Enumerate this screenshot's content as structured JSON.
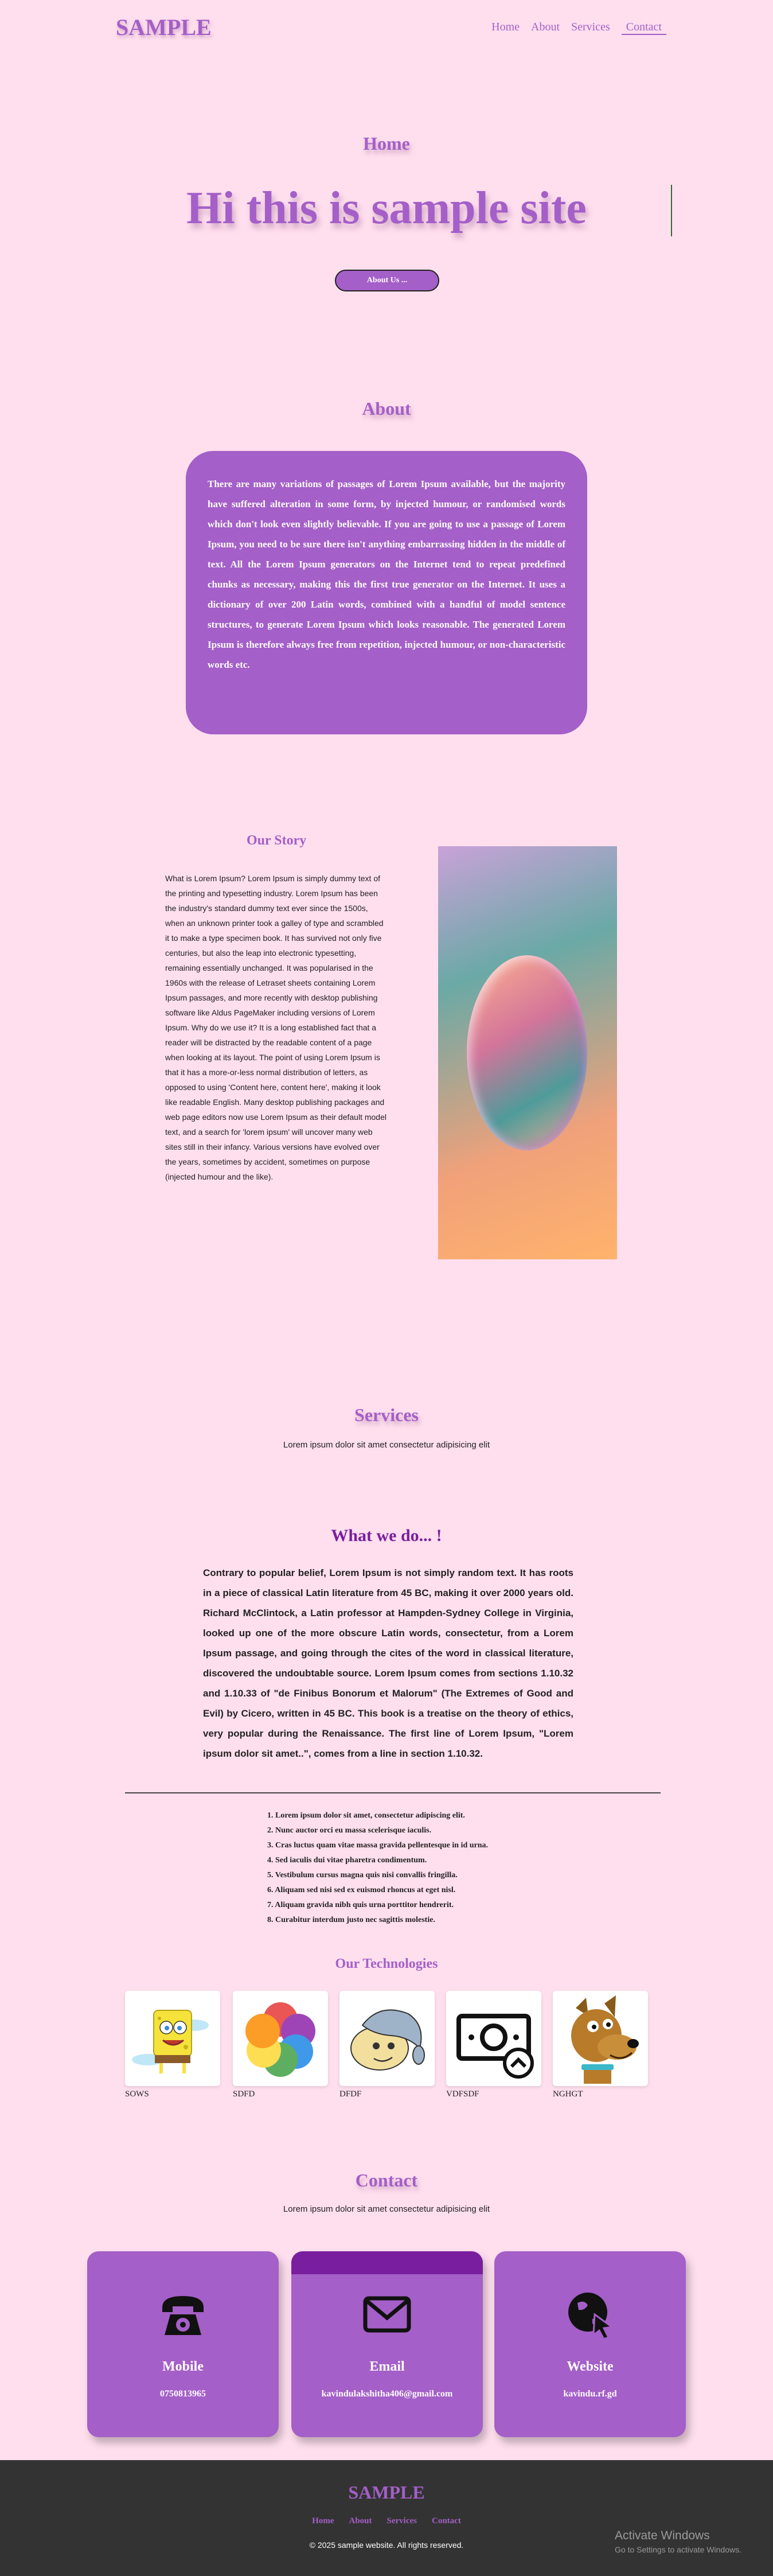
{
  "nav": {
    "logo": "SAMPLE",
    "links": [
      "Home",
      "About",
      "Services",
      "Contact"
    ]
  },
  "home": {
    "section_title": "Home",
    "hero": "Hi this is sample site",
    "button": "About Us ..."
  },
  "about": {
    "title": "About",
    "text": "There are many variations of passages of Lorem Ipsum available, but the majority have suffered alteration in some form, by injected humour, or randomised words which don't look even slightly believable. If you are going to use a passage of Lorem Ipsum, you need to be sure there isn't anything embarrassing hidden in the middle of text. All the Lorem Ipsum generators on the Internet tend to repeat predefined chunks as necessary, making this the first true generator on the Internet. It uses a dictionary of over 200 Latin words, combined with a handful of model sentence structures, to generate Lorem Ipsum which looks reasonable. The generated Lorem Ipsum is therefore always free from repetition, injected humour, or non-characteristic words etc."
  },
  "story": {
    "title": "Our Story",
    "text": "What is Lorem Ipsum? Lorem Ipsum is simply dummy text of the printing and typesetting industry. Lorem Ipsum has been the industry's standard dummy text ever since the 1500s, when an unknown printer took a galley of type and scrambled it to make a type specimen book. It has survived not only five centuries, but also the leap into electronic typesetting, remaining essentially unchanged. It was popularised in the 1960s with the release of Letraset sheets containing Lorem Ipsum passages, and more recently with desktop publishing software like Aldus PageMaker including versions of Lorem Ipsum. Why do we use it? It is a long established fact that a reader will be distracted by the readable content of a page when looking at its layout. The point of using Lorem Ipsum is that it has a more-or-less normal distribution of letters, as opposed to using 'Content here, content here', making it look like readable English. Many desktop publishing packages and web page editors now use Lorem Ipsum as their default model text, and a search for 'lorem ipsum' will uncover many web sites still in their infancy. Various versions have evolved over the years, sometimes by accident, sometimes on purpose (injected humour and the like)."
  },
  "services": {
    "title": "Services",
    "subtitle": "Lorem ipsum dolor sit amet consectetur adipisicing elit",
    "what_title": "What we do... !",
    "what_text": "Contrary to popular belief, Lorem Ipsum is not simply random text. It has roots in a piece of classical Latin literature from 45 BC, making it over 2000 years old. Richard McClintock, a Latin professor at Hampden-Sydney College in Virginia, looked up one of the more obscure Latin words, consectetur, from a Lorem Ipsum passage, and going through the cites of the word in classical literature, discovered the undoubtable source. Lorem Ipsum comes from sections 1.10.32 and 1.10.33 of \"de Finibus Bonorum et Malorum\" (The Extremes of Good and Evil) by Cicero, written in 45 BC. This book is a treatise on the theory of ethics, very popular during the Renaissance. The first line of Lorem Ipsum, \"Lorem ipsum dolor sit amet..\", comes from a line in section 1.10.32.",
    "list": [
      "1. Lorem ipsum dolor sit amet, consectetur adipiscing elit.",
      "2. Nunc auctor orci eu massa scelerisque iaculis.",
      "3. Cras luctus quam vitae massa gravida pellentesque in id urna.",
      "4. Sed iaculis dui vitae pharetra condimentum.",
      "5. Vestibulum cursus magna quis nisi convallis fringilla.",
      "6. Aliquam sed nisi sed ex euismod rhoncus at eget nisl.",
      "7. Aliquam gravida nibh quis urna porttitor hendrerit.",
      "8. Curabitur interdum justo nec sagittis molestie."
    ],
    "tech_title": "Our Technologies",
    "technologies": [
      {
        "label": "SOWS",
        "icon": "sponge-character-icon"
      },
      {
        "label": "SDFD",
        "icon": "color-flower-icon"
      },
      {
        "label": "DFDF",
        "icon": "cartoon-face-icon"
      },
      {
        "label": "VDFSDF",
        "icon": "money-icon"
      },
      {
        "label": "NGHGT",
        "icon": "cartoon-dog-icon"
      }
    ]
  },
  "contact": {
    "title": "Contact",
    "subtitle": "Lorem ipsum dolor sit amet consectetur adipisicing elit",
    "cards": [
      {
        "label": "Mobile",
        "value": "0750813965",
        "icon": "phone-icon"
      },
      {
        "label": "Email",
        "value": "kavindulakshitha406@gmail.com",
        "icon": "mail-icon"
      },
      {
        "label": "Website",
        "value": "kavindu.rf.gd",
        "icon": "globe-cursor-icon"
      }
    ]
  },
  "footer": {
    "logo": "SAMPLE",
    "links": [
      "Home",
      "About",
      "Services",
      "Contact"
    ],
    "copyright": "© 2025 sample website. All rights reserved."
  },
  "watermark": {
    "line1": "Activate Windows",
    "line2": "Go to Settings to activate Windows."
  },
  "colors": {
    "background": "#ffdfee",
    "accent": "#a45fc8",
    "dark_accent": "#7a1ea0",
    "footer": "#333333"
  }
}
